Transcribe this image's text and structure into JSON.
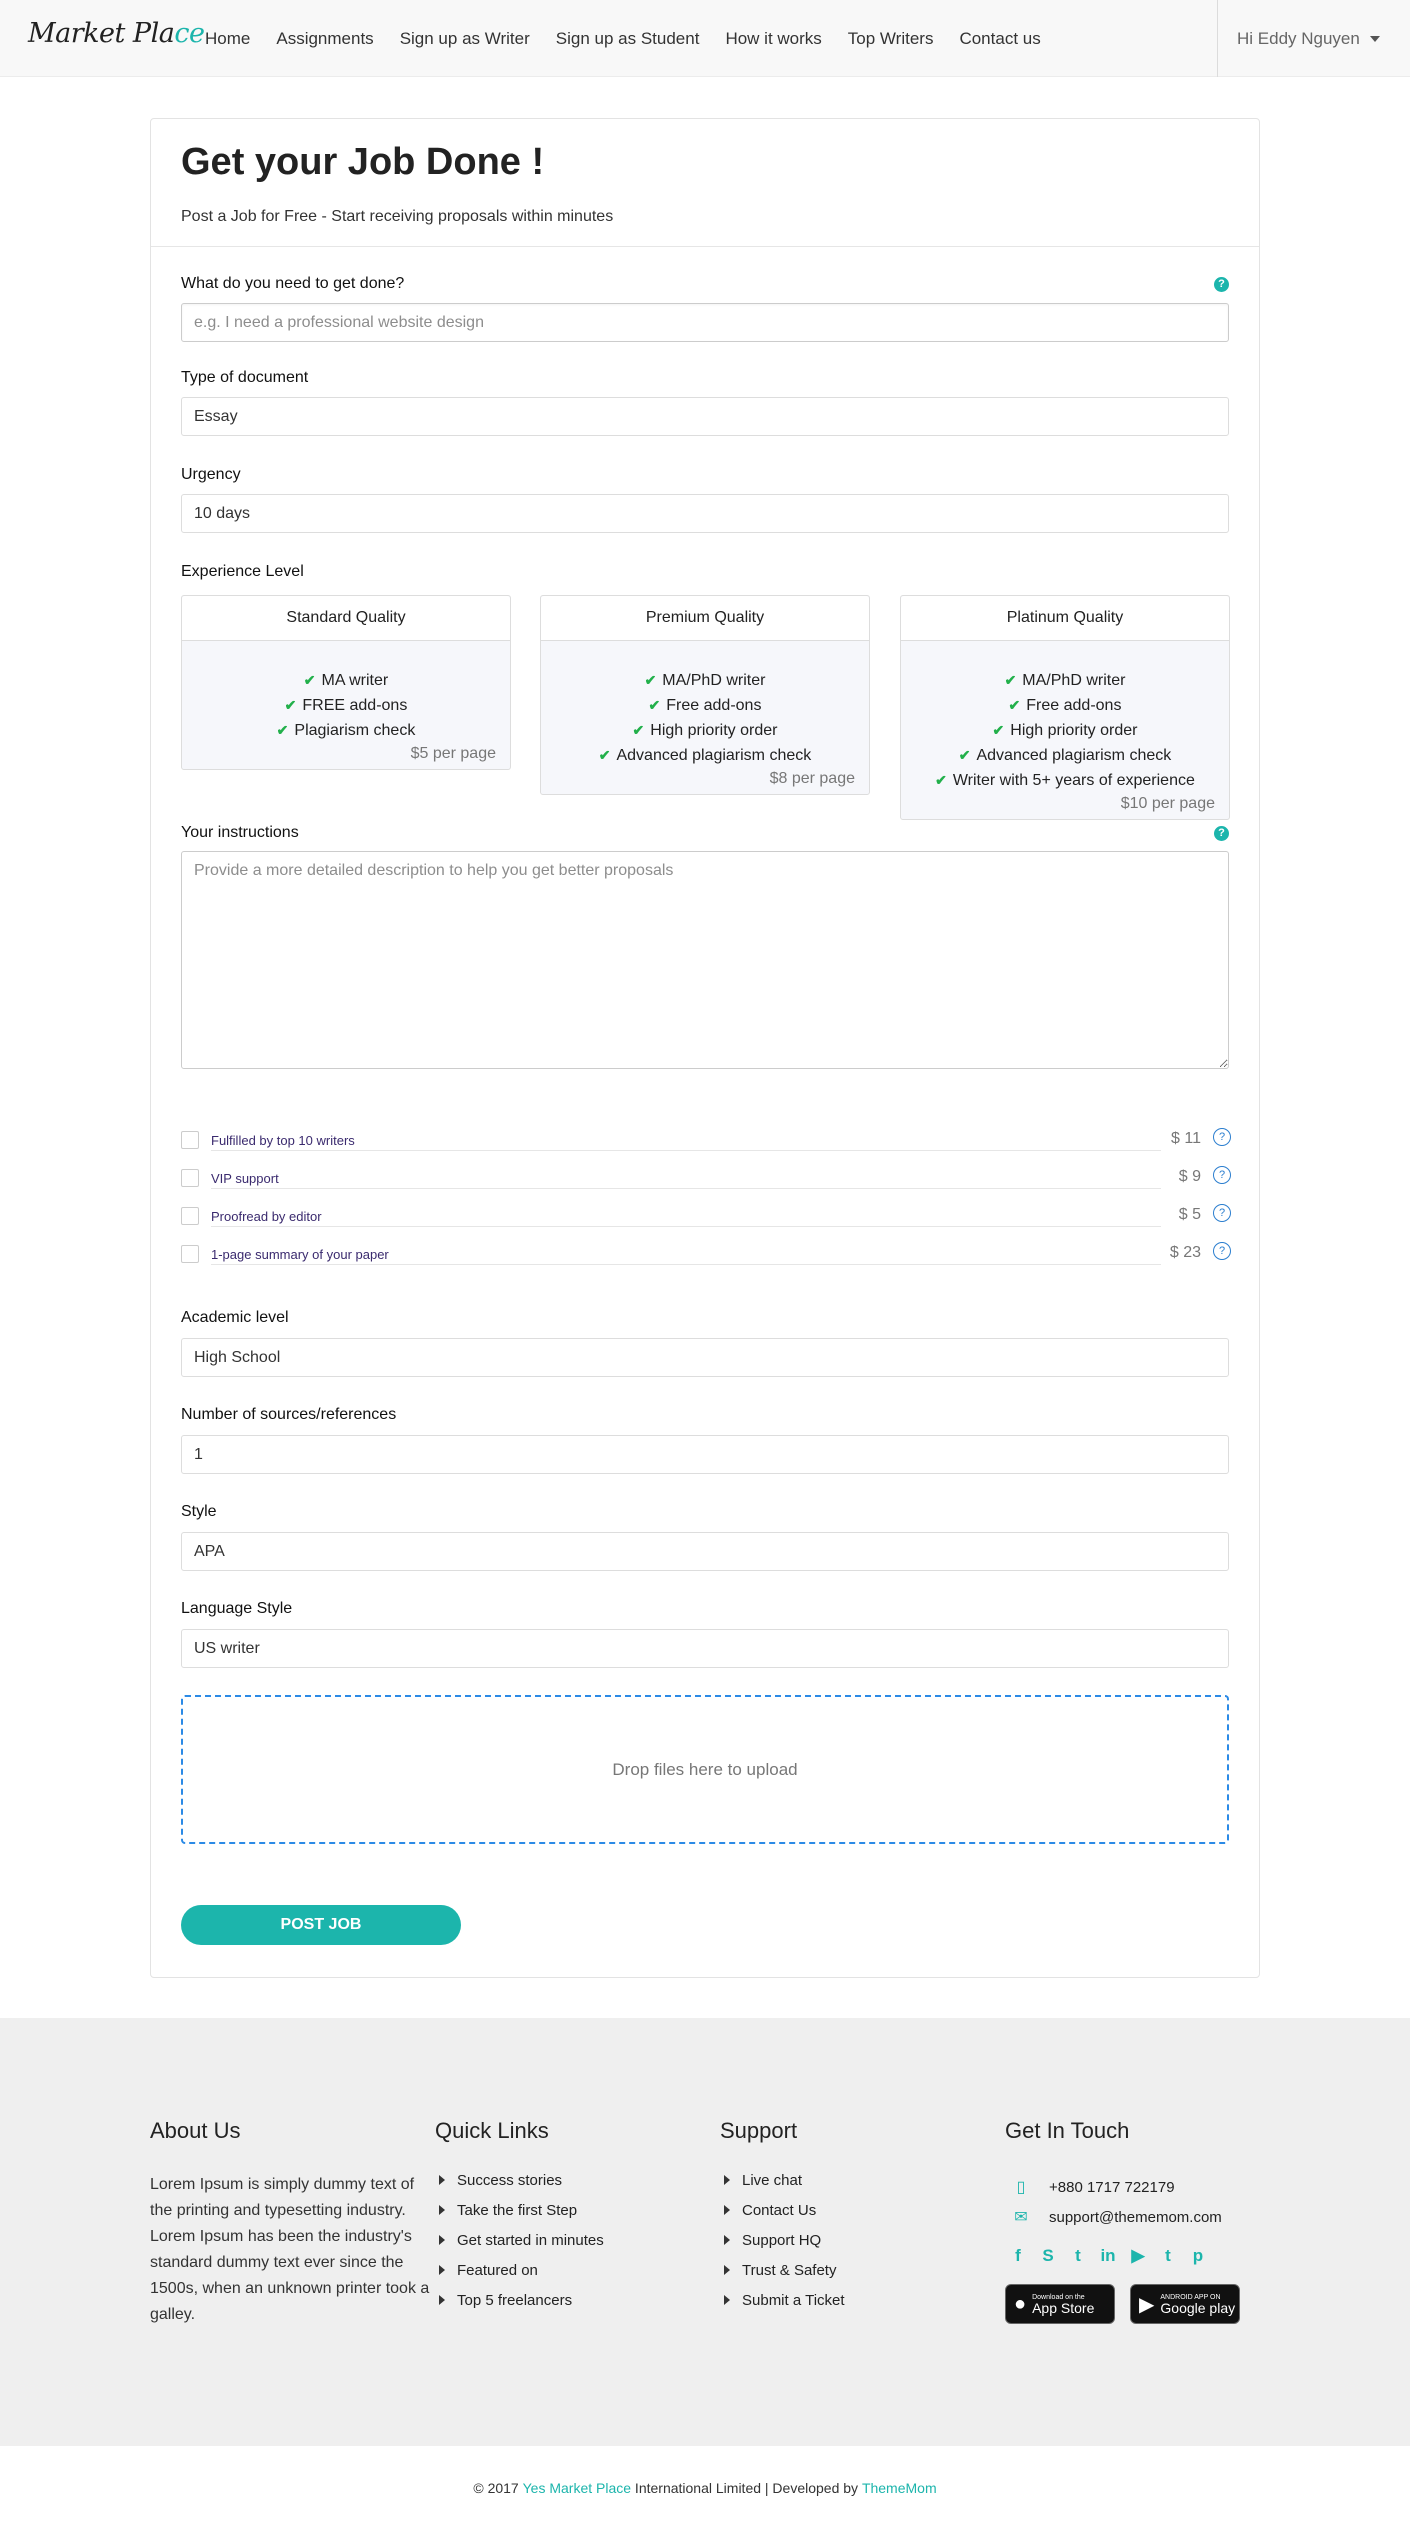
{
  "brand": {
    "logo_main": "Market Pla",
    "logo_accent": "ce"
  },
  "nav": {
    "links": [
      "Home",
      "Assignments",
      "Sign up as Writer",
      "Sign up as Student",
      "How it works",
      "Top Writers",
      "Contact us"
    ],
    "user": "Hi Eddy Nguyen"
  },
  "form": {
    "title": "Get your Job Done !",
    "subtitle": "Post a Job for Free - Start receiving proposals within minutes",
    "job": {
      "label": "What do you need to get done?",
      "placeholder": "e.g. I need a professional website design"
    },
    "doc_type": {
      "label": "Type of document",
      "value": "Essay"
    },
    "urgency": {
      "label": "Urgency",
      "value": "10 days"
    },
    "experience": {
      "label": "Experience Level",
      "options": [
        {
          "name": "Standard Quality",
          "features": [
            "MA writer",
            "FREE add-ons",
            "Plagiarism check"
          ],
          "price": "$5 per page"
        },
        {
          "name": "Premium Quality",
          "features": [
            "MA/PhD writer",
            "Free add-ons",
            "High priority order",
            "Advanced plagiarism check"
          ],
          "price": "$8 per page"
        },
        {
          "name": "Platinum Quality",
          "features": [
            "MA/PhD writer",
            "Free add-ons",
            "High priority order",
            "Advanced plagiarism check",
            "Writer with 5+ years of experience"
          ],
          "price": "$10 per page"
        }
      ]
    },
    "instructions": {
      "label": "Your instructions",
      "placeholder": "Provide a more detailed description to help you get better proposals"
    },
    "addons": [
      {
        "name": "Fulfilled by top 10 writers",
        "price": "$ 11"
      },
      {
        "name": "VIP support",
        "price": "$ 9"
      },
      {
        "name": "Proofread by editor",
        "price": "$ 5"
      },
      {
        "name": "1-page summary of your paper",
        "price": "$ 23"
      }
    ],
    "academic_level": {
      "label": "Academic level",
      "value": "High School"
    },
    "sources": {
      "label": "Number of sources/references",
      "value": "1"
    },
    "style": {
      "label": "Style",
      "value": "APA"
    },
    "language": {
      "label": "Language Style",
      "value": "US writer"
    },
    "dropzone": "Drop files here to upload",
    "submit": "POST JOB"
  },
  "footer": {
    "about": {
      "title": "About Us",
      "text": "Lorem Ipsum is simply dummy text of the printing and typesetting industry. Lorem Ipsum has been the industry's standard dummy text ever since the 1500s, when an unknown printer took a galley."
    },
    "quick_links": {
      "title": "Quick Links",
      "items": [
        "Success stories",
        "Take the first Step",
        "Get started in minutes",
        "Featured on",
        "Top 5 freelancers"
      ]
    },
    "support": {
      "title": "Support",
      "items": [
        "Live chat",
        "Contact Us",
        "Support HQ",
        "Trust & Safety",
        "Submit a Ticket"
      ]
    },
    "contact": {
      "title": "Get In Touch",
      "phone": "+880 1717 722179",
      "email": "support@thememom.com"
    },
    "stores": {
      "apple": {
        "small": "Download on the",
        "big": "App Store"
      },
      "google": {
        "small": "ANDROID APP ON",
        "big": "Google play"
      }
    }
  },
  "copyright": {
    "prefix": "© 2017 ",
    "brand": "Yes Market Place",
    "middle": " International Limited | Developed by ",
    "dev": "ThemeMom"
  },
  "colors": {
    "accent": "#1cb5ac",
    "check": "#22b04b",
    "dropzone_border": "#2b8ae6"
  }
}
